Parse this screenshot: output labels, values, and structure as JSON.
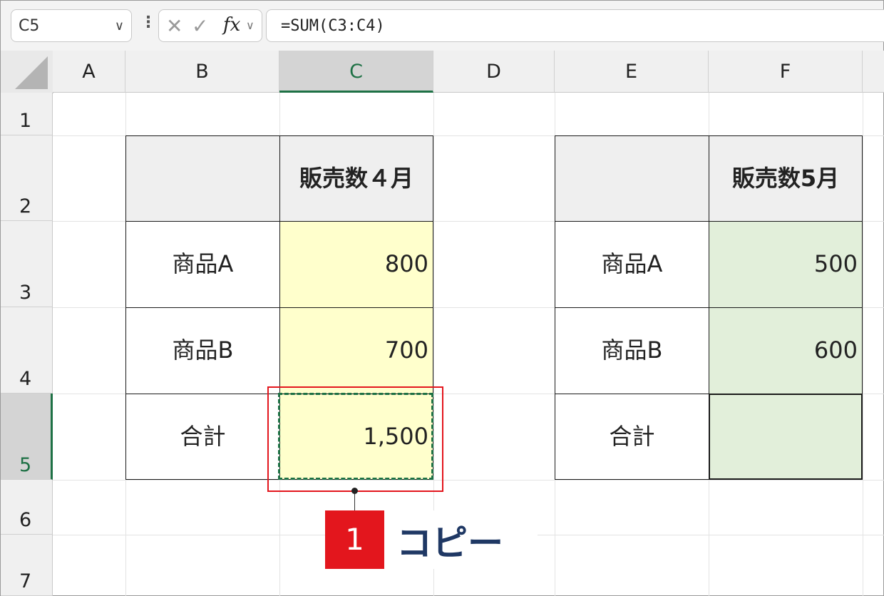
{
  "formula_bar": {
    "name_box": "C5",
    "name_box_caret": "∨",
    "more_dots": "⋮",
    "cancel_symbol": "✕",
    "enter_symbol": "✓",
    "fx_label": "fx",
    "fx_caret": "∨",
    "formula": "=SUM(C3:C4)"
  },
  "columns": [
    "A",
    "B",
    "C",
    "D",
    "E",
    "F"
  ],
  "selected_column": "C",
  "rows": [
    "1",
    "2",
    "3",
    "4",
    "5",
    "6",
    "7"
  ],
  "selected_row": "5",
  "table1": {
    "header": "販売数４月",
    "rows": [
      {
        "label": "商品A",
        "value": "800"
      },
      {
        "label": "商品B",
        "value": "700"
      },
      {
        "label": "合計",
        "value": "1,500"
      }
    ]
  },
  "table2": {
    "header": "販売数5月",
    "rows": [
      {
        "label": "商品A",
        "value": "500"
      },
      {
        "label": "商品B",
        "value": "600"
      },
      {
        "label": "合計",
        "value": ""
      }
    ]
  },
  "annotation": {
    "step_number": "1",
    "text": "コピー"
  },
  "colors": {
    "accent_green": "#1e7145",
    "highlight_red": "#e3161d",
    "cell_yellow": "#ffffcc",
    "cell_green": "#e2efda",
    "callout_text": "#1f3864"
  }
}
